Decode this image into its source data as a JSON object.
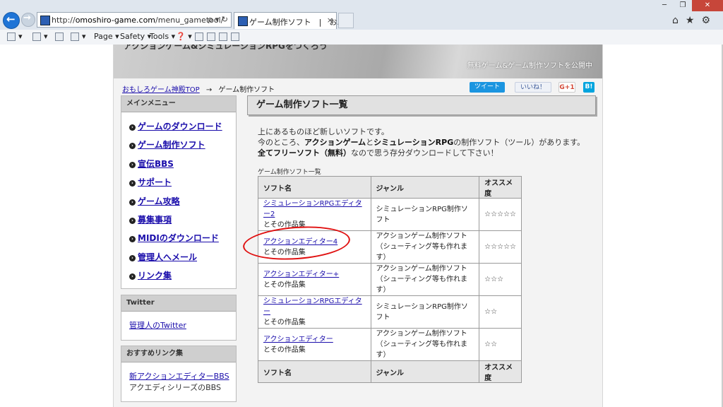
{
  "browser": {
    "address_url_prefix": "http://",
    "address_url_domain": "omoshiro-game.com",
    "address_url_path": "/menu_gametool/",
    "address_controls": "ρ ▾ ↻",
    "tab_title": "ゲーム制作ソフト　|　お...",
    "tab_close": "×",
    "window_controls": [
      "─",
      "❐",
      "✕"
    ],
    "toolbar_icons": "⌂★⚙",
    "command_bar": {
      "home_arrow": "▾",
      "feeds_arrow": "▾",
      "print_arrow": "▾",
      "page_label": "Page ▾",
      "safety_label": "Safety ▾",
      "tools_label": "Tools ▾",
      "help_label": "❓ ▾"
    }
  },
  "banner": {
    "title": "アクションゲーム&シミュレーションRPGをつくろう",
    "subtitle": "無料ゲーム&ゲーム制作ソフトを公開中"
  },
  "breadcrumb": {
    "home_link": "おもしろゲーム神殿TOP",
    "arrow": "→",
    "current": "ゲーム制作ソフト"
  },
  "social": {
    "tweet": "ツイート",
    "facebook": "いいね！",
    "gplus": "G+1",
    "hatena": "B!"
  },
  "sidebar": {
    "main_menu": {
      "heading": "メインメニュー",
      "bullet": "›",
      "items": [
        {
          "label": "ゲームのダウンロード"
        },
        {
          "label": "ゲーム制作ソフト"
        },
        {
          "label": "宣伝BBS"
        },
        {
          "label": "サポート"
        },
        {
          "label": "ゲーム攻略"
        },
        {
          "label": "募集事項"
        },
        {
          "label": "MIDIのダウンロード"
        },
        {
          "label": "管理人へメール"
        },
        {
          "label": "リンク集"
        }
      ]
    },
    "twitter": {
      "heading": "Twitter",
      "link": "管理人のTwitter"
    },
    "links": {
      "heading": "おすすめリンク集",
      "link": "新アクションエディターBBS",
      "text": "アクエディシリーズのBBS"
    }
  },
  "main": {
    "title": "ゲーム制作ソフト一覧",
    "intro_line1": "上にあるものほど新しいソフトです。",
    "intro_line2_a": "今のところ、",
    "intro_line2_b": "アクションゲーム",
    "intro_line2_c": "と",
    "intro_line2_d": "シミュレーションRPG",
    "intro_line2_e": "の制作ソフト（ツール）があります。",
    "intro_line3_a": "全てフリーソフト（無料）",
    "intro_line3_b": "なので思う存分ダウンロードして下さい！",
    "table_caption": "ゲーム制作ソフト一覧",
    "columns": [
      "ソフト名",
      "ジャンル",
      "オススメ度"
    ],
    "rows": [
      {
        "name": "シミュレーションRPGエディター2",
        "sub": "とその作品集",
        "genre1": "シミュレーションRPG制作ソフト",
        "genre2": "",
        "stars": "☆☆☆☆☆"
      },
      {
        "name": "アクションエディター4",
        "sub": "とその作品集",
        "genre1": "アクションゲーム制作ソフト",
        "genre2": "（シューティング等も作れます）",
        "stars": "☆☆☆☆☆"
      },
      {
        "name": "アクションエディター+",
        "sub": "とその作品集",
        "genre1": "アクションゲーム制作ソフト",
        "genre2": "（シューティング等も作れます）",
        "stars": "☆☆☆"
      },
      {
        "name": "シミュレーションRPGエディター",
        "sub": "とその作品集",
        "genre1": "シミュレーションRPG制作ソフト",
        "genre2": "",
        "stars": "☆☆"
      },
      {
        "name": "アクションエディター",
        "sub": "とその作品集",
        "genre1": "アクションゲーム制作ソフト",
        "genre2": "（シューティング等も作れます）",
        "stars": "☆☆"
      }
    ]
  }
}
